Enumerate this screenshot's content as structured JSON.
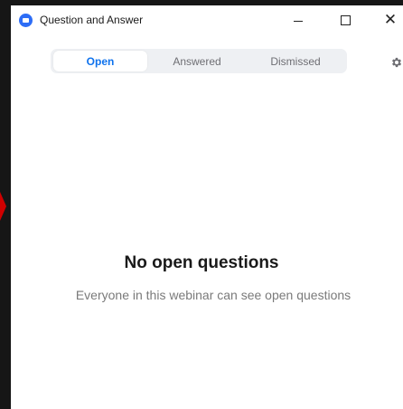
{
  "window": {
    "title": "Question and Answer",
    "icons": {
      "app": "zoom-logo-icon",
      "minimize": "minimize-icon",
      "maximize": "maximize-icon",
      "close": "close-icon",
      "settings": "gear-icon"
    }
  },
  "tabs": [
    {
      "label": "Open",
      "selected": true
    },
    {
      "label": "Answered",
      "selected": false
    },
    {
      "label": "Dismissed",
      "selected": false
    }
  ],
  "empty_state": {
    "title": "No open questions",
    "subtitle": "Everyone in this webinar can see open questions"
  },
  "colors": {
    "accent": "#0e72ed",
    "logo": "#2d6df6",
    "backdrop": "#161616",
    "arrow": "#d00000"
  }
}
